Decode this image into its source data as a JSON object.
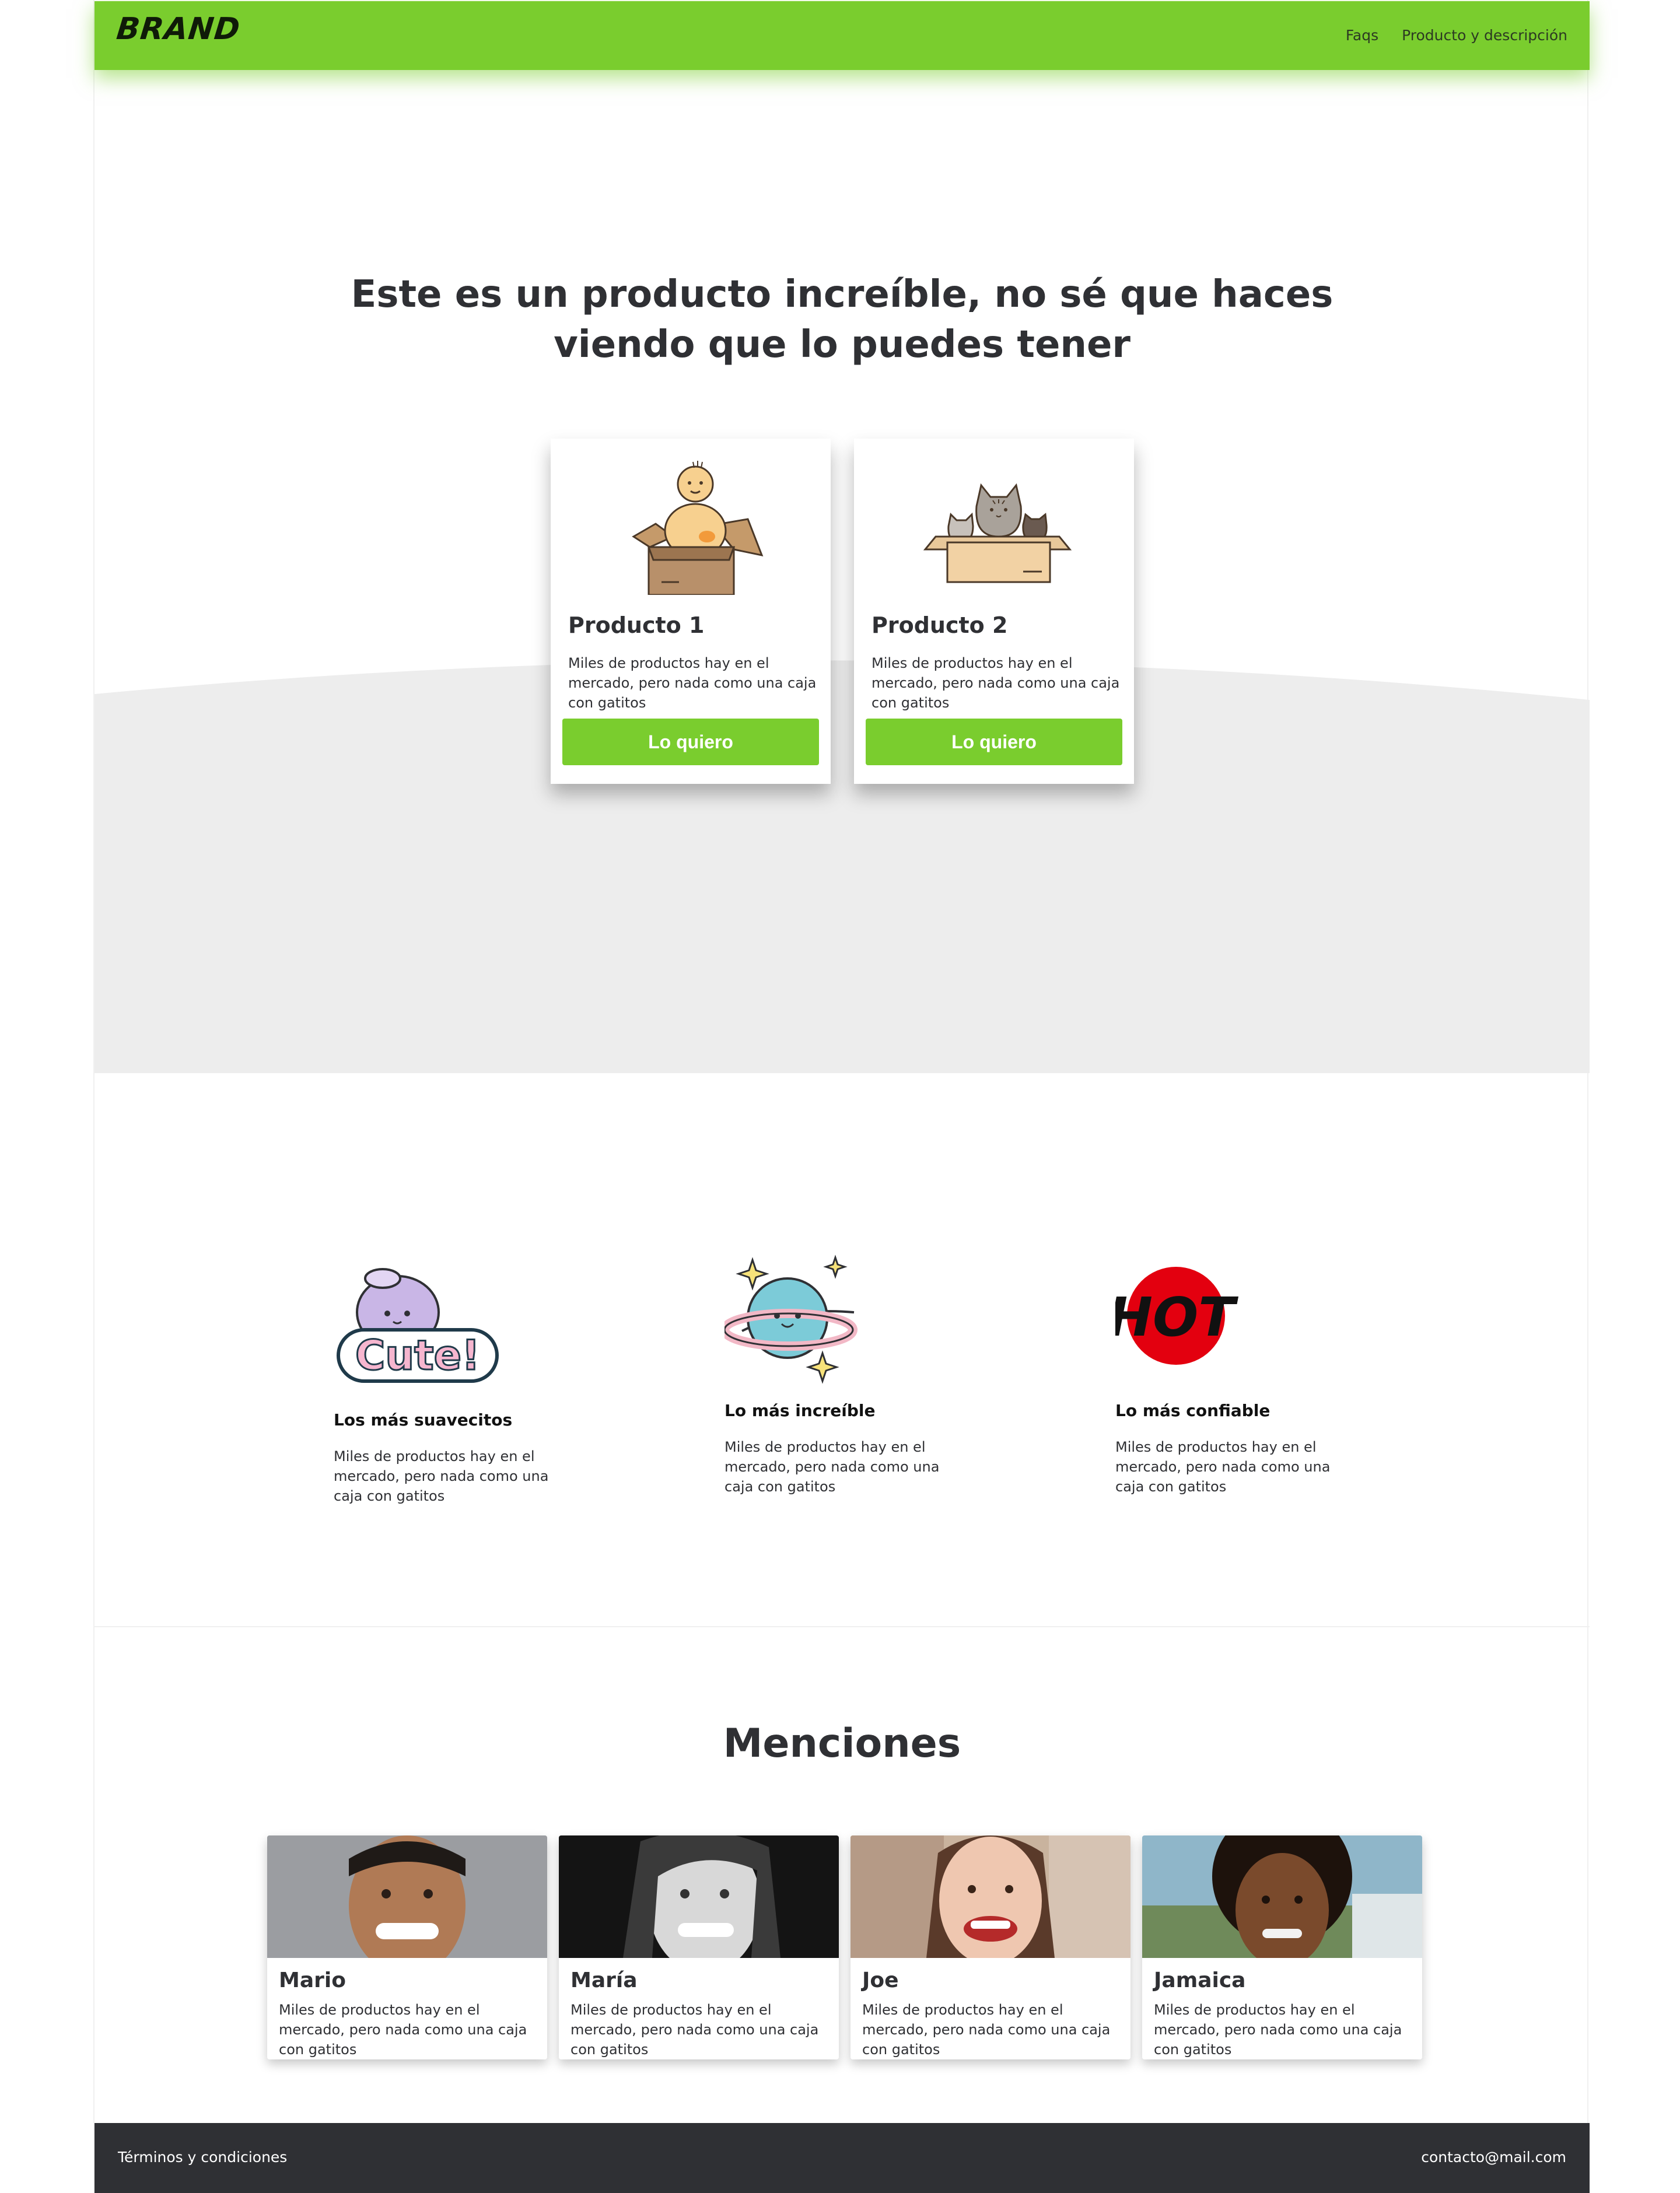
{
  "header": {
    "brand": "BRAND",
    "nav": [
      "Faqs",
      "Producto y descripción"
    ]
  },
  "hero": {
    "title_line1": "Este es un producto increíble, no sé que haces",
    "title_line2": "viendo que lo puedes tener"
  },
  "products": [
    {
      "title": "Producto 1",
      "description": "Miles de productos hay en el mercado, pero nada como una caja con gatitos",
      "button": "Lo quiero",
      "illustration": "baby-in-box"
    },
    {
      "title": "Producto 2",
      "description": "Miles de productos hay en el mercado, pero nada como una caja con gatitos",
      "button": "Lo quiero",
      "illustration": "cats-in-box"
    }
  ],
  "features": [
    {
      "title": "Los más suavecitos",
      "description": "Miles de productos hay en el mercado, pero nada como una caja con gatitos",
      "icon": "cute-sticker-icon"
    },
    {
      "title": "Lo más increíble",
      "description": "Miles de productos hay en el mercado, pero nada como una caja con gatitos",
      "icon": "planet-icon"
    },
    {
      "title": "Lo más confiable",
      "description": "Miles de productos hay en el mercado, pero nada como una caja con gatitos",
      "icon": "hot-badge-icon"
    }
  ],
  "mentions": {
    "title": "Menciones",
    "people": [
      {
        "name": "Mario",
        "description": "Miles de productos hay en el mercado, pero nada como una caja con gatitos"
      },
      {
        "name": "María",
        "description": "Miles de productos hay en el mercado, pero nada como una caja con gatitos"
      },
      {
        "name": "Joe",
        "description": "Miles de productos hay en el mercado, pero nada como una caja con gatitos"
      },
      {
        "name": "Jamaica",
        "description": "Miles de productos hay en el mercado, pero nada como una caja con gatitos"
      }
    ]
  },
  "footer": {
    "left": "Términos y condiciones",
    "right": "contacto@mail.com"
  },
  "colors": {
    "accent": "#7acd2e",
    "text": "#2f3034",
    "footer_bg": "#2f3034",
    "section_bg": "#ededed"
  }
}
